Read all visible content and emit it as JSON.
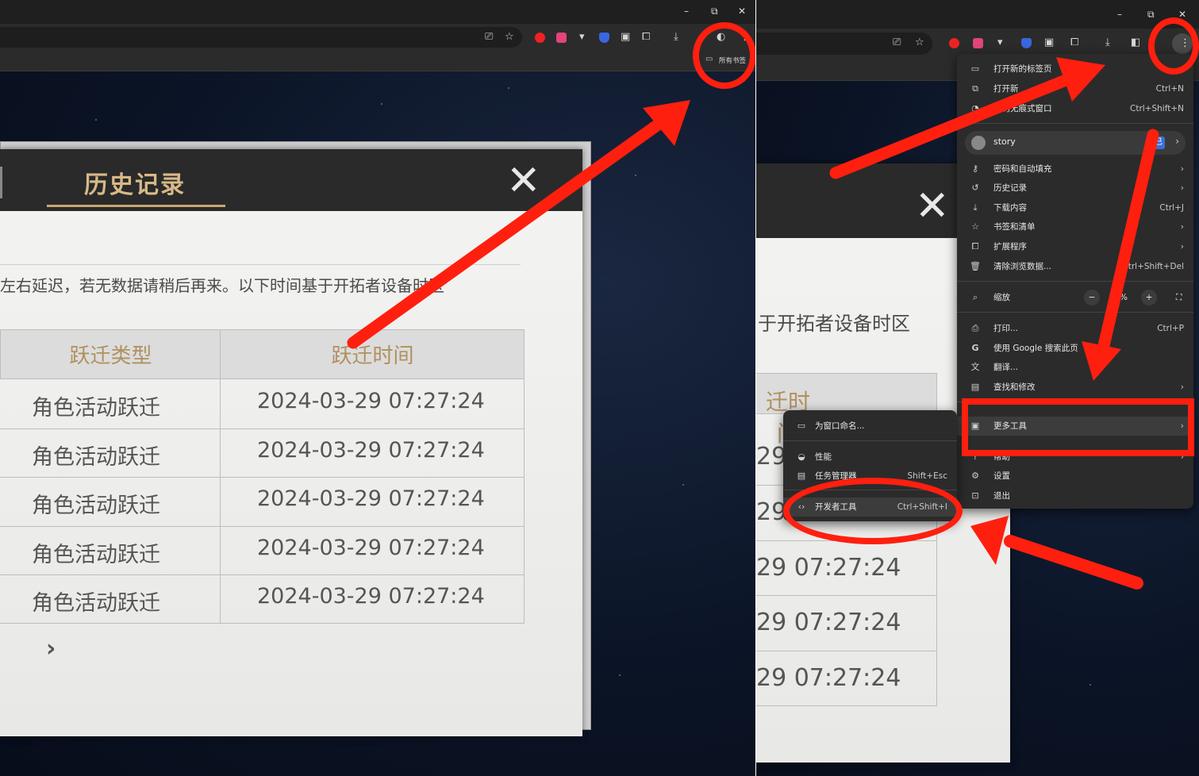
{
  "left": {
    "bookmarks_label": "所有书签",
    "dialog": {
      "title": "历史记录",
      "note": "左右延迟，若无数据请稍后再来。以下时间基于开拓者设备时区",
      "columns": [
        "跃迁类型",
        "跃迁时间"
      ],
      "rows": [
        {
          "type": "角色活动跃迁",
          "time": "2024-03-29 07:27:24"
        },
        {
          "type": "角色活动跃迁",
          "time": "2024-03-29 07:27:24"
        },
        {
          "type": "角色活动跃迁",
          "time": "2024-03-29 07:27:24"
        },
        {
          "type": "角色活动跃迁",
          "time": "2024-03-29 07:27:24"
        },
        {
          "type": "角色活动跃迁",
          "time": "2024-03-29 07:27:24"
        }
      ],
      "pager_next": "›"
    }
  },
  "right": {
    "bg_note": "于开拓者设备时区",
    "bg_header": "迁时间",
    "bg_rows": [
      "29",
      "29",
      "29 07:27:24",
      "29 07:27:24",
      "29 07:27:24"
    ],
    "main_menu": {
      "new_tab": {
        "label": "打开新的标签页",
        "shortcut": ""
      },
      "new_window": {
        "label": "打开新",
        "shortcut": "Ctrl+N"
      },
      "incognito": {
        "label": "新的无痕式窗口",
        "shortcut": "Ctrl+Shift+N"
      },
      "profile_name": "story",
      "profile_badge": "已",
      "passwords": "密码和自动填充",
      "history": "历史记录",
      "downloads": {
        "label": "下载内容",
        "shortcut": "Ctrl+J"
      },
      "bookmarks": "书签和清单",
      "extensions": "扩展程序",
      "clear_data": {
        "label": "清除浏览数据...",
        "shortcut": "trl+Shift+Del"
      },
      "zoom": {
        "label": "缩放",
        "minus": "−",
        "value": "%",
        "plus": "+"
      },
      "print": {
        "label": "打印...",
        "shortcut": "Ctrl+P"
      },
      "google_search": "使用 Google 搜索此页",
      "translate": "翻译...",
      "find": "查找和修改",
      "more_tools": "更多工具",
      "help": "帮助",
      "settings": "设置",
      "exit": "退出"
    },
    "sub_menu": {
      "name_window": "为窗口命名...",
      "performance": "性能",
      "task_manager": {
        "label": "任务管理器",
        "shortcut": "Shift+Esc"
      },
      "dev_tools": {
        "label": "开发者工具",
        "shortcut": "Ctrl+Shift+I"
      }
    }
  },
  "colors": {
    "annotation": "#ff1f0f",
    "accent": "#caa571",
    "menu_bg": "#2b2b2b"
  }
}
